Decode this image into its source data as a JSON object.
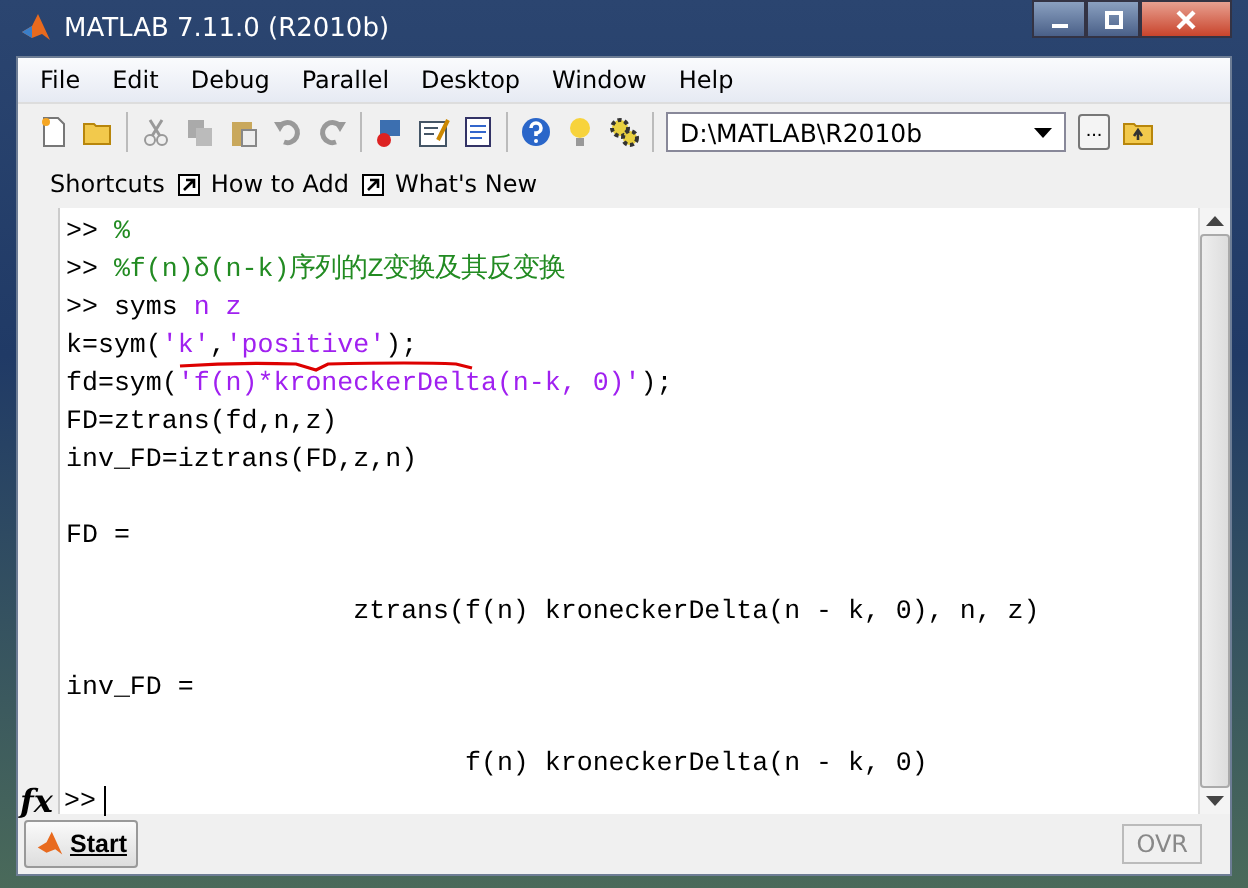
{
  "window": {
    "title": "MATLAB  7.11.0 (R2010b)"
  },
  "menu": [
    "File",
    "Edit",
    "Debug",
    "Parallel",
    "Desktop",
    "Window",
    "Help"
  ],
  "toolbar": {
    "path": "D:\\MATLAB\\R2010b",
    "browse": "..."
  },
  "shortcuts": {
    "label": "Shortcuts",
    "links": [
      "How to Add",
      "What's New"
    ]
  },
  "console": [
    {
      "spaced": false,
      "segments": [
        {
          "kind": "plain",
          "text": ">> "
        },
        {
          "kind": "comment",
          "text": "%"
        }
      ]
    },
    {
      "spaced": false,
      "segments": [
        {
          "kind": "plain",
          "text": ">> "
        },
        {
          "kind": "comment",
          "text": "%f(n)δ(n-k)序列的Z变换及其反变换"
        }
      ]
    },
    {
      "spaced": false,
      "segments": [
        {
          "kind": "plain",
          "text": ">> syms "
        },
        {
          "kind": "string",
          "text": "n z"
        }
      ]
    },
    {
      "spaced": false,
      "segments": [
        {
          "kind": "plain",
          "text": "k=sym("
        },
        {
          "kind": "string",
          "text": "'k'"
        },
        {
          "kind": "plain",
          "text": ","
        },
        {
          "kind": "string",
          "text": "'positive'"
        },
        {
          "kind": "plain",
          "text": ");"
        }
      ]
    },
    {
      "spaced": false,
      "segments": [
        {
          "kind": "plain",
          "text": "fd=sym("
        },
        {
          "kind": "string",
          "text": "'f(n)*kroneckerDelta(n-k, 0)'"
        },
        {
          "kind": "plain",
          "text": ");"
        }
      ]
    },
    {
      "spaced": false,
      "segments": [
        {
          "kind": "plain",
          "text": "FD=ztrans(fd,n,z)"
        }
      ]
    },
    {
      "spaced": false,
      "segments": [
        {
          "kind": "plain",
          "text": "inv_FD=iztrans(FD,z,n)"
        }
      ]
    },
    {
      "spaced": true,
      "segments": [
        {
          "kind": "plain",
          "text": "FD ="
        }
      ]
    },
    {
      "spaced": true,
      "segments": [
        {
          "kind": "plain",
          "text": "                  ztrans(f(n) kroneckerDelta(n - k, 0), n, z)"
        }
      ]
    },
    {
      "spaced": true,
      "segments": [
        {
          "kind": "plain",
          "text": "inv_FD ="
        }
      ]
    },
    {
      "spaced": true,
      "segments": [
        {
          "kind": "plain",
          "text": "                         f(n) kroneckerDelta(n - k, 0)"
        }
      ]
    }
  ],
  "prompt": {
    "fx": "fx",
    "text": ">>"
  },
  "status": {
    "start": "Start",
    "mode": "OVR"
  }
}
